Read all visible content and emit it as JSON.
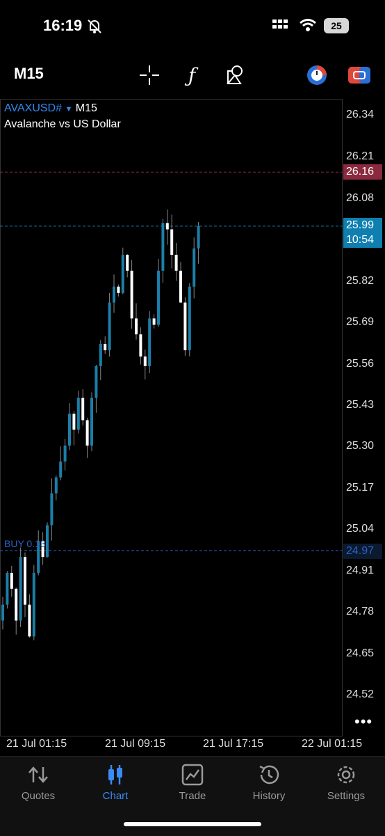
{
  "status_bar": {
    "time": "16:19",
    "battery": "25"
  },
  "toolbar": {
    "period": "M15",
    "icons": [
      "crosshair-icon",
      "indicators-icon",
      "objects-icon",
      "timer-icon",
      "trade-toggle-icon"
    ]
  },
  "symbol": {
    "ticker": "AVAXUSD#",
    "timeframe": "M15",
    "description": "Avalanche vs US Dollar"
  },
  "price_axis": [
    "26.34",
    "26.21",
    "26.08",
    "25.82",
    "25.69",
    "25.56",
    "25.43",
    "25.30",
    "25.17",
    "25.04",
    "24.91",
    "24.78",
    "24.65",
    "24.52"
  ],
  "ask_tag": {
    "price": "26.16",
    "color": "#8b2a3e"
  },
  "bid_tag": {
    "price": "25.99",
    "timer": "10:54",
    "color": "#0f7fb0"
  },
  "position_line": {
    "label": "BUY 0.13",
    "price": "24.97"
  },
  "time_axis": [
    "21 Jul 01:15",
    "21 Jul 09:15",
    "21 Jul 17:15",
    "22 Jul 01:15"
  ],
  "more_icon": "more-icon",
  "tabs": [
    {
      "label": "Quotes",
      "icon": "quotes-icon",
      "active": false
    },
    {
      "label": "Chart",
      "icon": "chart-icon",
      "active": true
    },
    {
      "label": "Trade",
      "icon": "trade-icon",
      "active": false
    },
    {
      "label": "History",
      "icon": "history-icon",
      "active": false
    },
    {
      "label": "Settings",
      "icon": "settings-icon",
      "active": false
    }
  ],
  "colors": {
    "bull": "#1a7fa8",
    "bear": "#ffffff",
    "accent": "#3a8bf5"
  }
}
